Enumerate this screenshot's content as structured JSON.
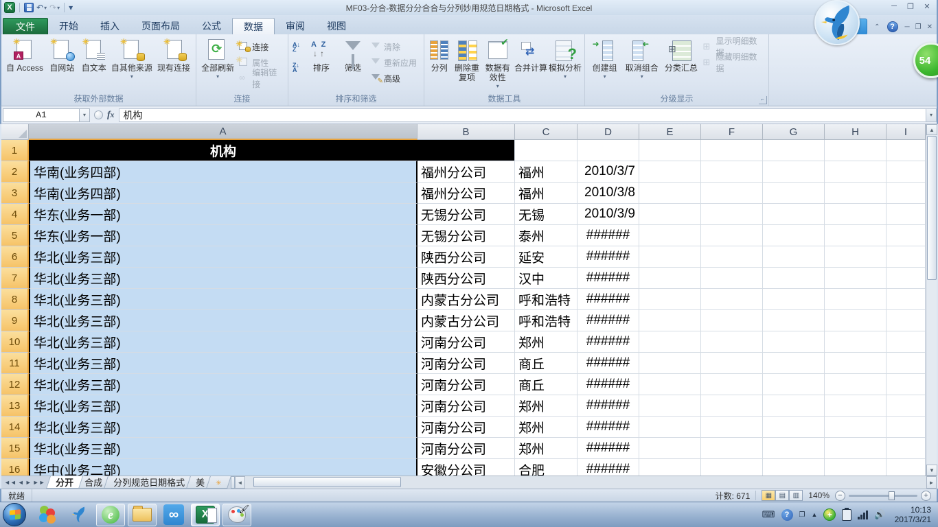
{
  "window": {
    "title": "MF03-分合-数据分分合合与分列妙用规范日期格式  -  Microsoft Excel",
    "controls": {
      "minimize": "─",
      "restore": "❐",
      "close": "✕"
    }
  },
  "quick_access": {
    "undo": "↶",
    "redo": "↷",
    "customize": "▾"
  },
  "ribbon": {
    "tabs": [
      {
        "label": "文件"
      },
      {
        "label": "开始"
      },
      {
        "label": "插入"
      },
      {
        "label": "页面布局"
      },
      {
        "label": "公式"
      },
      {
        "label": "数据"
      },
      {
        "label": "审阅"
      },
      {
        "label": "视图"
      }
    ],
    "active_tab": "数据",
    "get_external": {
      "label": "获取外部数据",
      "btns": [
        "自 Access",
        "自网站",
        "自文本",
        "自其他来源",
        "现有连接"
      ]
    },
    "connections": {
      "label": "连接",
      "refresh": "全部刷新",
      "items": [
        "连接",
        "属性",
        "编辑链接"
      ]
    },
    "sort_filter": {
      "label": "排序和筛选",
      "sort": "排序",
      "filter": "筛选",
      "items": [
        "清除",
        "重新应用",
        "高级"
      ]
    },
    "data_tools": {
      "label": "数据工具",
      "btns": [
        "分列",
        "删除重复项",
        "数据有效性",
        "合并计算",
        "模拟分析"
      ]
    },
    "outline": {
      "label": "分级显示",
      "btns": [
        "创建组",
        "取消组合",
        "分类汇总"
      ],
      "items": [
        "显示明细数据",
        "隐藏明细数据"
      ]
    },
    "overlay_ball": "54"
  },
  "formula_bar": {
    "name_box": "A1",
    "value": "机构"
  },
  "sheet": {
    "columns": [
      "A",
      "B",
      "C",
      "D",
      "E",
      "F",
      "G",
      "H",
      "I"
    ],
    "selected_column": "A",
    "rows": [
      {
        "n": "1",
        "a": "机构",
        "b": "",
        "c": "",
        "d": ""
      },
      {
        "n": "2",
        "a": "华南(业务四部)",
        "b": "福州分公司",
        "c": "福州",
        "d": "2010/3/7"
      },
      {
        "n": "3",
        "a": "华南(业务四部)",
        "b": "福州分公司",
        "c": "福州",
        "d": "2010/3/8"
      },
      {
        "n": "4",
        "a": "华东(业务一部)",
        "b": "无锡分公司",
        "c": "无锡",
        "d": "2010/3/9"
      },
      {
        "n": "5",
        "a": "华东(业务一部)",
        "b": "无锡分公司",
        "c": "泰州",
        "d": "######"
      },
      {
        "n": "6",
        "a": "华北(业务三部)",
        "b": "陕西分公司",
        "c": "延安",
        "d": "######"
      },
      {
        "n": "7",
        "a": "华北(业务三部)",
        "b": "陕西分公司",
        "c": "汉中",
        "d": "######"
      },
      {
        "n": "8",
        "a": "华北(业务三部)",
        "b": "内蒙古分公司",
        "c": "呼和浩特",
        "d": "######"
      },
      {
        "n": "9",
        "a": "华北(业务三部)",
        "b": "内蒙古分公司",
        "c": "呼和浩特",
        "d": "######"
      },
      {
        "n": "10",
        "a": "华北(业务三部)",
        "b": "河南分公司",
        "c": "郑州",
        "d": "######"
      },
      {
        "n": "11",
        "a": "华北(业务三部)",
        "b": "河南分公司",
        "c": "商丘",
        "d": "######"
      },
      {
        "n": "12",
        "a": "华北(业务三部)",
        "b": "河南分公司",
        "c": "商丘",
        "d": "######"
      },
      {
        "n": "13",
        "a": "华北(业务三部)",
        "b": "河南分公司",
        "c": "郑州",
        "d": "######"
      },
      {
        "n": "14",
        "a": "华北(业务三部)",
        "b": "河南分公司",
        "c": "郑州",
        "d": "######"
      },
      {
        "n": "15",
        "a": "华北(业务三部)",
        "b": "河南分公司",
        "c": "郑州",
        "d": "######"
      },
      {
        "n": "16",
        "a": "华中(业务二部)",
        "b": "安徽分公司",
        "c": "合肥",
        "d": "######"
      }
    ]
  },
  "sheet_tabs": [
    {
      "label": "分开",
      "active": true
    },
    {
      "label": "合成",
      "active": false
    },
    {
      "label": "分列规范日期格式",
      "active": false
    },
    {
      "label": "美",
      "active": false
    }
  ],
  "status_bar": {
    "mode": "就绪",
    "count": "计数: 671",
    "zoom": "140%"
  },
  "taskbar": {
    "time": "10:13",
    "date": "2017/3/21"
  }
}
